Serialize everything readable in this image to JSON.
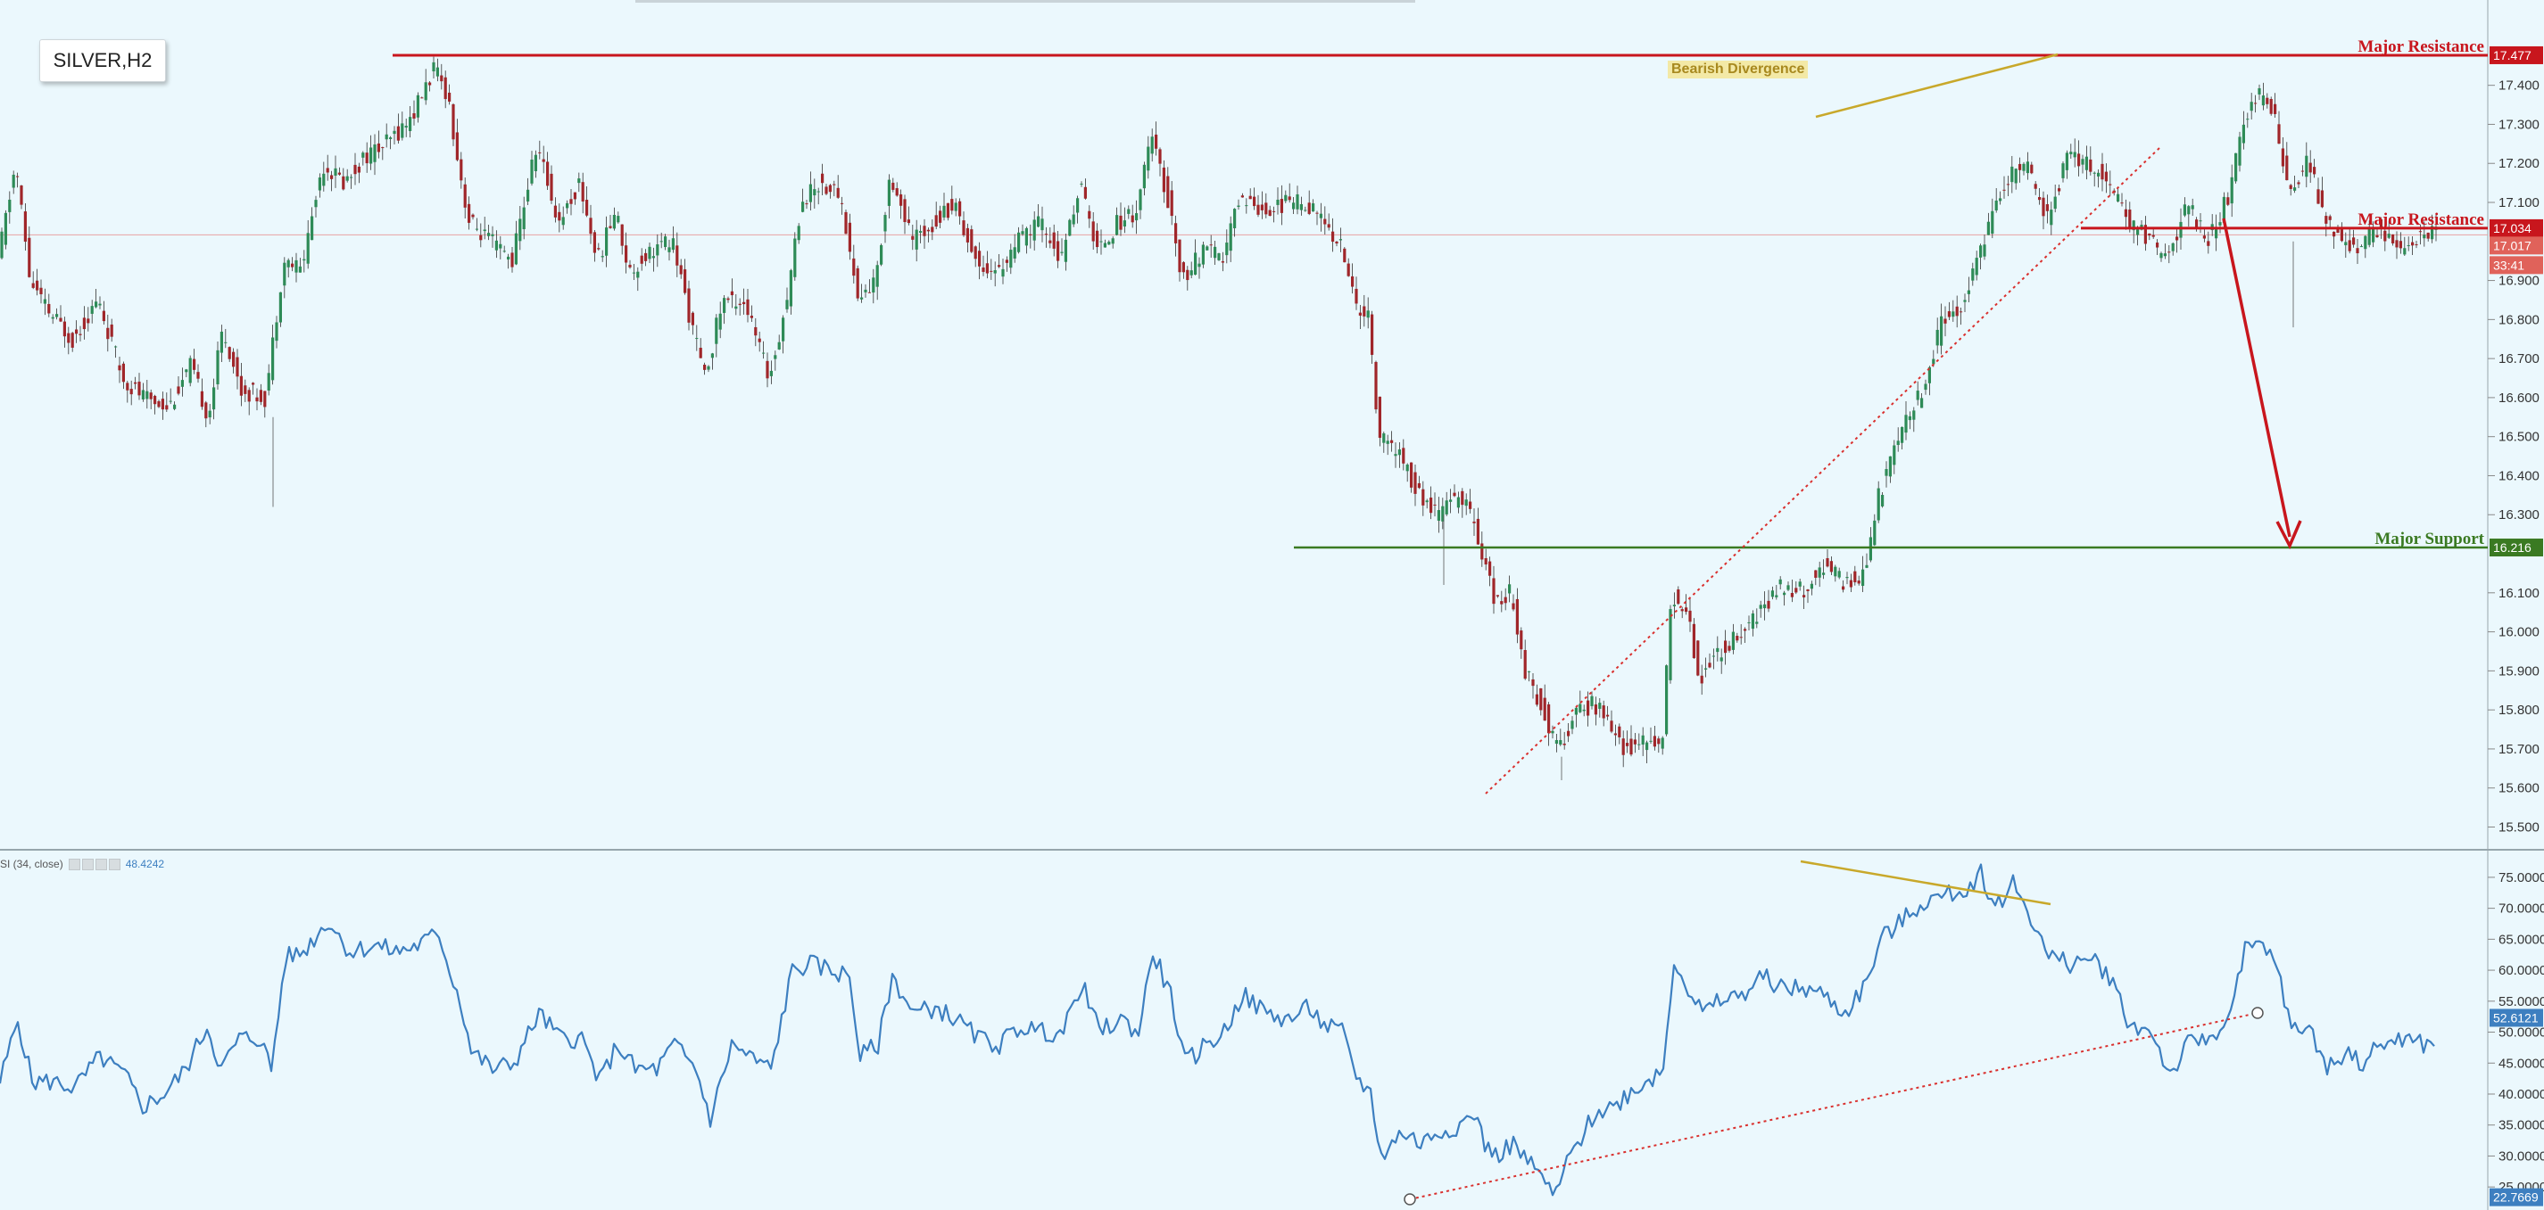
{
  "symbol": "SILVER,H2",
  "annotation": "Bearish Divergence",
  "levels": [
    {
      "label": "Major Resistance",
      "value": 17.477,
      "tag": "17.477",
      "color": "#c8161d"
    },
    {
      "label": "Major Resistance",
      "value": 17.034,
      "tag": "17.034",
      "color": "#c8161d"
    },
    {
      "label": "Major Support",
      "value": 16.216,
      "tag": "16.216",
      "color": "#3a7a22"
    }
  ],
  "current_price_tag": "17.017",
  "countdown_tag": "33:41",
  "oscillator": {
    "label": "SI (34, close)",
    "value": "48.4242",
    "trend_tag": "52.6121",
    "low_tag": "22.7669",
    "color": "#3d7fc0"
  },
  "colors": {
    "background": "#ebf8fd",
    "bull_candle": "#2e8b57",
    "bear_candle": "#a0262a",
    "divergence": "#c8a82a",
    "trendline": "#d9302e"
  },
  "chart_data": {
    "type": "candlestick",
    "price_axis": {
      "ticks": [
        "17.400",
        "17.300",
        "17.200",
        "17.100",
        "16.900",
        "16.800",
        "16.700",
        "16.600",
        "16.500",
        "16.400",
        "16.300",
        "16.100",
        "16.000",
        "15.900",
        "15.800",
        "15.700",
        "15.600",
        "15.500"
      ],
      "range": [
        15.46,
        17.55
      ]
    },
    "oscillator_axis": {
      "ticks": [
        "75.0000",
        "70.0000",
        "65.0000",
        "60.0000",
        "55.0000",
        "50.0000",
        "45.0000",
        "40.0000",
        "35.0000",
        "30.0000",
        "25.0000"
      ],
      "range": [
        22,
        77
      ]
    },
    "price_path": [
      [
        0,
        16.95
      ],
      [
        10,
        17.2
      ],
      [
        18,
        16.9
      ],
      [
        28,
        16.82
      ],
      [
        42,
        16.75
      ],
      [
        56,
        16.85
      ],
      [
        70,
        16.65
      ],
      [
        82,
        16.6
      ],
      [
        96,
        16.58
      ],
      [
        108,
        16.68
      ],
      [
        118,
        16.55
      ],
      [
        126,
        16.78
      ],
      [
        136,
        16.62
      ],
      [
        150,
        16.6
      ],
      [
        160,
        16.95
      ],
      [
        170,
        16.93
      ],
      [
        182,
        17.2
      ],
      [
        194,
        17.15
      ],
      [
        206,
        17.22
      ],
      [
        218,
        17.25
      ],
      [
        232,
        17.32
      ],
      [
        244,
        17.44
      ],
      [
        252,
        17.38
      ],
      [
        258,
        17.2
      ],
      [
        264,
        17.05
      ],
      [
        276,
        17.0
      ],
      [
        288,
        16.95
      ],
      [
        302,
        17.25
      ],
      [
        314,
        17.05
      ],
      [
        326,
        17.15
      ],
      [
        336,
        16.95
      ],
      [
        346,
        17.08
      ],
      [
        354,
        16.92
      ],
      [
        366,
        16.98
      ],
      [
        378,
        17.0
      ],
      [
        388,
        16.8
      ],
      [
        396,
        16.65
      ],
      [
        406,
        16.85
      ],
      [
        418,
        16.85
      ],
      [
        432,
        16.65
      ],
      [
        442,
        16.85
      ],
      [
        450,
        17.1
      ],
      [
        460,
        17.15
      ],
      [
        472,
        17.12
      ],
      [
        482,
        16.85
      ],
      [
        492,
        16.9
      ],
      [
        500,
        17.18
      ],
      [
        512,
        17.0
      ],
      [
        524,
        17.05
      ],
      [
        536,
        17.1
      ],
      [
        548,
        16.95
      ],
      [
        560,
        16.92
      ],
      [
        572,
        17.0
      ],
      [
        584,
        17.05
      ],
      [
        596,
        16.95
      ],
      [
        606,
        17.15
      ],
      [
        616,
        16.98
      ],
      [
        628,
        17.05
      ],
      [
        638,
        17.08
      ],
      [
        646,
        17.27
      ],
      [
        656,
        17.1
      ],
      [
        664,
        16.9
      ],
      [
        676,
        16.98
      ],
      [
        686,
        16.95
      ],
      [
        696,
        17.12
      ],
      [
        710,
        17.08
      ],
      [
        722,
        17.1
      ],
      [
        734,
        17.1
      ],
      [
        742,
        17.05
      ],
      [
        752,
        17.0
      ],
      [
        760,
        16.85
      ],
      [
        768,
        16.8
      ],
      [
        774,
        16.5
      ],
      [
        786,
        16.45
      ],
      [
        796,
        16.35
      ],
      [
        806,
        16.3
      ],
      [
        818,
        16.35
      ],
      [
        826,
        16.3
      ],
      [
        832,
        16.2
      ],
      [
        838,
        16.08
      ],
      [
        848,
        16.1
      ],
      [
        856,
        15.9
      ],
      [
        866,
        15.8
      ],
      [
        874,
        15.7
      ],
      [
        884,
        15.78
      ],
      [
        894,
        15.82
      ],
      [
        904,
        15.75
      ],
      [
        912,
        15.7
      ],
      [
        922,
        15.72
      ],
      [
        932,
        15.7
      ],
      [
        938,
        16.1
      ],
      [
        946,
        16.05
      ],
      [
        954,
        15.88
      ],
      [
        964,
        15.95
      ],
      [
        976,
        16.0
      ],
      [
        988,
        16.05
      ],
      [
        1000,
        16.12
      ],
      [
        1012,
        16.1
      ],
      [
        1022,
        16.18
      ],
      [
        1034,
        16.12
      ],
      [
        1046,
        16.15
      ],
      [
        1054,
        16.35
      ],
      [
        1066,
        16.5
      ],
      [
        1078,
        16.62
      ],
      [
        1090,
        16.8
      ],
      [
        1102,
        16.85
      ],
      [
        1112,
        17.0
      ],
      [
        1124,
        17.15
      ],
      [
        1136,
        17.2
      ],
      [
        1148,
        17.05
      ],
      [
        1160,
        17.22
      ],
      [
        1172,
        17.2
      ],
      [
        1182,
        17.15
      ],
      [
        1194,
        17.05
      ],
      [
        1206,
        17.0
      ],
      [
        1216,
        16.95
      ],
      [
        1226,
        17.1
      ],
      [
        1238,
        17.0
      ],
      [
        1250,
        17.12
      ],
      [
        1258,
        17.3
      ],
      [
        1266,
        17.38
      ],
      [
        1276,
        17.32
      ],
      [
        1284,
        17.1
      ],
      [
        1294,
        17.22
      ],
      [
        1304,
        17.05
      ],
      [
        1314,
        17.0
      ],
      [
        1324,
        16.98
      ],
      [
        1334,
        17.04
      ],
      [
        1346,
        16.98
      ],
      [
        1358,
        17.02
      ],
      [
        1366,
        17.02
      ]
    ],
    "oscillator_path": [
      [
        0,
        42
      ],
      [
        10,
        52
      ],
      [
        18,
        42
      ],
      [
        30,
        42
      ],
      [
        42,
        41
      ],
      [
        56,
        46
      ],
      [
        70,
        43
      ],
      [
        80,
        38
      ],
      [
        92,
        40
      ],
      [
        104,
        44
      ],
      [
        116,
        51
      ],
      [
        124,
        44
      ],
      [
        134,
        49
      ],
      [
        146,
        49
      ],
      [
        152,
        44
      ],
      [
        160,
        62
      ],
      [
        170,
        63
      ],
      [
        184,
        68
      ],
      [
        196,
        63
      ],
      [
        210,
        64
      ],
      [
        222,
        63
      ],
      [
        234,
        64
      ],
      [
        246,
        66
      ],
      [
        252,
        60
      ],
      [
        258,
        55
      ],
      [
        264,
        47
      ],
      [
        276,
        44
      ],
      [
        288,
        45
      ],
      [
        302,
        53
      ],
      [
        314,
        49
      ],
      [
        326,
        49
      ],
      [
        336,
        42
      ],
      [
        346,
        48
      ],
      [
        356,
        44
      ],
      [
        368,
        44
      ],
      [
        378,
        48
      ],
      [
        390,
        44
      ],
      [
        398,
        36
      ],
      [
        410,
        48
      ],
      [
        420,
        46
      ],
      [
        432,
        44
      ],
      [
        444,
        60
      ],
      [
        454,
        61
      ],
      [
        466,
        60
      ],
      [
        476,
        59
      ],
      [
        482,
        46
      ],
      [
        492,
        48
      ],
      [
        500,
        59
      ],
      [
        512,
        53
      ],
      [
        524,
        54
      ],
      [
        536,
        52
      ],
      [
        548,
        49
      ],
      [
        560,
        48
      ],
      [
        572,
        51
      ],
      [
        584,
        50
      ],
      [
        596,
        50
      ],
      [
        606,
        58
      ],
      [
        616,
        50
      ],
      [
        628,
        52
      ],
      [
        638,
        50
      ],
      [
        646,
        63
      ],
      [
        656,
        56
      ],
      [
        664,
        45
      ],
      [
        676,
        48
      ],
      [
        686,
        50
      ],
      [
        696,
        56
      ],
      [
        710,
        53
      ],
      [
        722,
        52
      ],
      [
        734,
        54
      ],
      [
        742,
        51
      ],
      [
        752,
        50
      ],
      [
        760,
        43
      ],
      [
        768,
        40
      ],
      [
        774,
        30
      ],
      [
        786,
        34
      ],
      [
        796,
        32
      ],
      [
        806,
        34
      ],
      [
        818,
        35
      ],
      [
        826,
        37
      ],
      [
        832,
        32
      ],
      [
        838,
        30
      ],
      [
        848,
        32
      ],
      [
        856,
        29
      ],
      [
        866,
        26
      ],
      [
        870,
        23
      ],
      [
        880,
        30
      ],
      [
        894,
        37
      ],
      [
        904,
        38
      ],
      [
        912,
        40
      ],
      [
        922,
        42
      ],
      [
        932,
        44
      ],
      [
        938,
        62
      ],
      [
        946,
        57
      ],
      [
        954,
        53
      ],
      [
        964,
        55
      ],
      [
        976,
        56
      ],
      [
        988,
        59
      ],
      [
        1000,
        57
      ],
      [
        1012,
        57
      ],
      [
        1022,
        56
      ],
      [
        1034,
        53
      ],
      [
        1046,
        58
      ],
      [
        1054,
        65
      ],
      [
        1066,
        68
      ],
      [
        1078,
        71
      ],
      [
        1090,
        72
      ],
      [
        1102,
        73
      ],
      [
        1110,
        76
      ],
      [
        1118,
        70
      ],
      [
        1128,
        74
      ],
      [
        1136,
        70
      ],
      [
        1148,
        62
      ],
      [
        1160,
        61
      ],
      [
        1172,
        62
      ],
      [
        1182,
        59
      ],
      [
        1194,
        51
      ],
      [
        1206,
        50
      ],
      [
        1216,
        43
      ],
      [
        1226,
        48
      ],
      [
        1238,
        49
      ],
      [
        1250,
        53
      ],
      [
        1258,
        63
      ],
      [
        1266,
        64
      ],
      [
        1276,
        61
      ],
      [
        1284,
        50
      ],
      [
        1294,
        51
      ],
      [
        1304,
        44
      ],
      [
        1314,
        47
      ],
      [
        1324,
        45
      ],
      [
        1334,
        48
      ],
      [
        1346,
        49
      ],
      [
        1358,
        48
      ],
      [
        1366,
        48
      ]
    ]
  }
}
